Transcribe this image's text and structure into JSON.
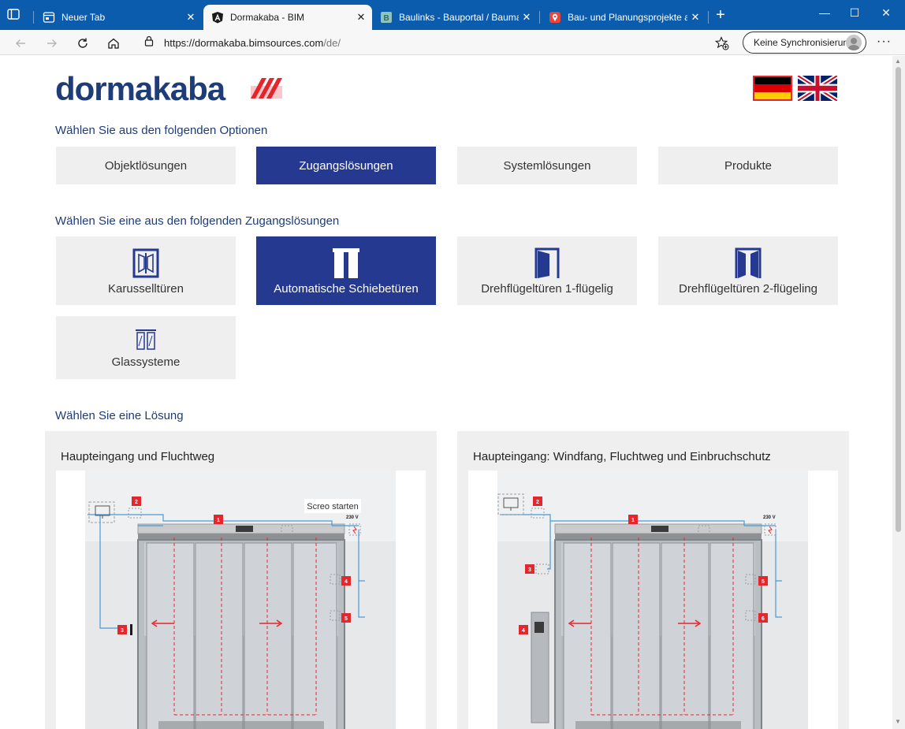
{
  "browser": {
    "tabs": [
      {
        "title": "Neuer Tab",
        "close": "✕"
      },
      {
        "title": "Dormakaba - BIM",
        "close": "✕"
      },
      {
        "title": "Baulinks - Bauportal / Baumagaz",
        "close": "✕"
      },
      {
        "title": "Bau- und Planungsprojekte auf B",
        "close": "✕"
      }
    ],
    "new_tab": "+",
    "window_controls": {
      "minimize": "—",
      "maximize": "☐",
      "close": "✕"
    },
    "url_host": "https://dormakaba.bimsources.com",
    "url_path": "/de/",
    "sync_label": "Keine Synchronisierung",
    "more_label": "···"
  },
  "site": {
    "logo_text": "dormakaba",
    "languages": [
      "Deutsch",
      "English"
    ],
    "colors": {
      "brand_blue": "#1e3c78",
      "active_blue": "#263990",
      "brand_red": "#e5262d",
      "tile_gray": "#efefef"
    }
  },
  "options": {
    "heading": "Wählen Sie aus den folgenden Optionen",
    "items": [
      "Objektlösungen",
      "Zugangslösungen",
      "Systemlösungen",
      "Produkte"
    ],
    "selected": "Zugangslösungen"
  },
  "access": {
    "heading": "Wählen Sie eine aus den folgenden Zugangslösungen",
    "items": [
      {
        "label": "Karusselltüren",
        "icon": "revolving-door-icon"
      },
      {
        "label": "Automatische Schiebetüren",
        "icon": "sliding-door-icon"
      },
      {
        "label": "Drehflügeltüren 1-flügelig",
        "icon": "single-swing-door-icon"
      },
      {
        "label": "Drehflügeltüren 2-flügeling",
        "icon": "double-swing-door-icon"
      },
      {
        "label": "Glassysteme",
        "icon": "glass-system-icon"
      }
    ],
    "selected": "Automatische Schiebetüren"
  },
  "solutions": {
    "heading": "Wählen Sie eine Lösung",
    "cards": [
      {
        "title": "Haupteingang und Fluchtweg",
        "overlay": "Screo starten",
        "voltage": "230 V",
        "markers": [
          "1",
          "2",
          "3",
          "4",
          "5"
        ]
      },
      {
        "title": "Haupteingang: Windfang, Fluchtweg und Einbruchschutz",
        "voltage": "230 V",
        "markers": [
          "1",
          "2",
          "3",
          "4",
          "5",
          "6"
        ]
      }
    ]
  }
}
